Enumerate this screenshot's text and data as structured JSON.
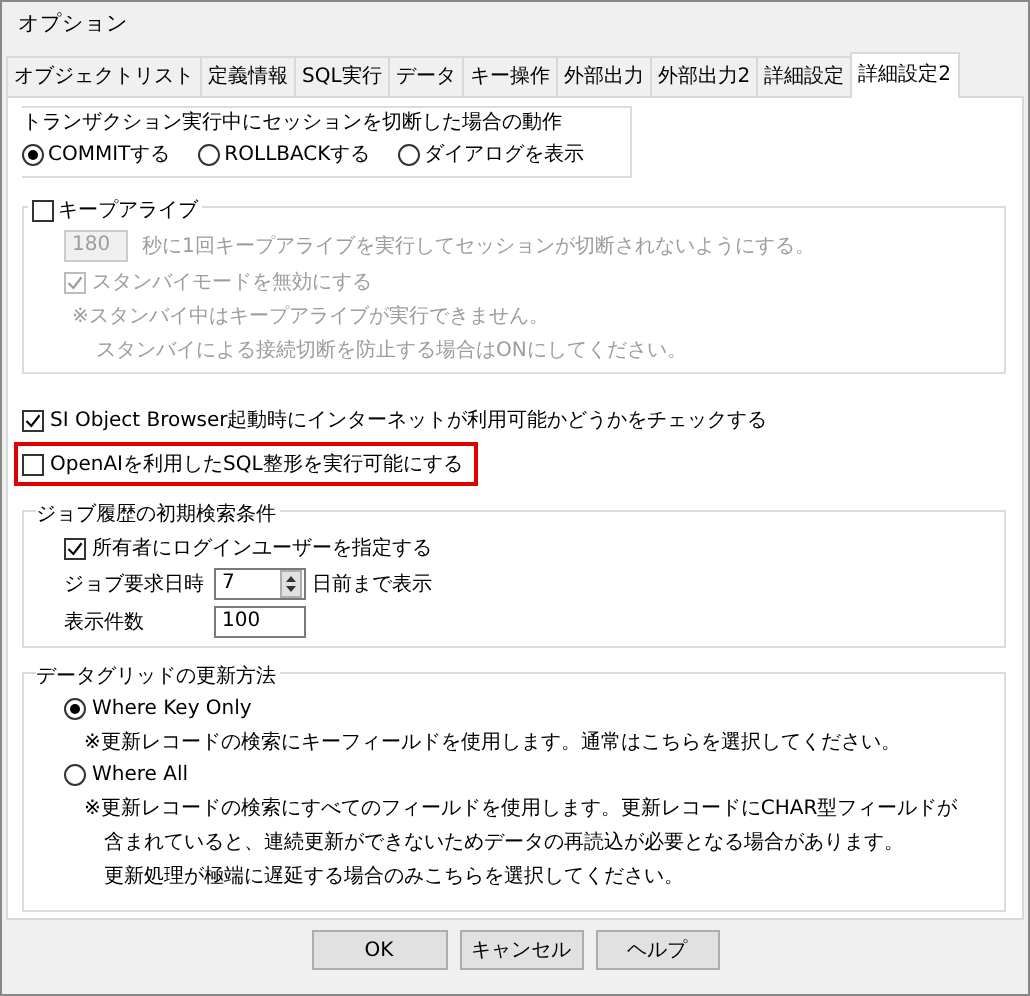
{
  "window": {
    "title": "オプション"
  },
  "tabs": [
    {
      "label": "オブジェクトリスト",
      "selected": false
    },
    {
      "label": "定義情報",
      "selected": false
    },
    {
      "label": "SQL実行",
      "selected": false
    },
    {
      "label": "データ",
      "selected": false
    },
    {
      "label": "キー操作",
      "selected": false
    },
    {
      "label": "外部出力",
      "selected": false
    },
    {
      "label": "外部出力2",
      "selected": false
    },
    {
      "label": "詳細設定",
      "selected": false
    },
    {
      "label": "詳細設定2",
      "selected": true
    }
  ],
  "transaction_group": {
    "title": "トランザクション実行中にセッションを切断した場合の動作",
    "options": [
      {
        "label": "COMMITする",
        "selected": true
      },
      {
        "label": "ROLLBACKする",
        "selected": false
      },
      {
        "label": "ダイアログを表示",
        "selected": false
      }
    ]
  },
  "keepalive_group": {
    "label": "キープアライブ",
    "checked": false,
    "disabled": true,
    "interval": "180",
    "interval_text": "秒に1回キープアライブを実行してセッションが切断されないようにする。",
    "standby": {
      "label": "スタンバイモードを無効にする",
      "checked": true
    },
    "notes": [
      "※スタンバイ中はキープアライブが実行できません。",
      "スタンバイによる接続切断を防止する場合はONにしてください。"
    ]
  },
  "options": [
    {
      "label": "SI Object Browser起動時にインターネットが利用可能かどうかをチェックする",
      "checked": true,
      "highlighted": false
    },
    {
      "label": "OpenAIを利用したSQL整形を実行可能にする",
      "checked": false,
      "highlighted": true
    }
  ],
  "job_history_group": {
    "title": "ジョブ履歴の初期検索条件",
    "owner": {
      "label": "所有者にログインユーザーを指定する",
      "checked": true
    },
    "request_date": {
      "label": "ジョブ要求日時",
      "value": "7",
      "suffix": "日前まで表示"
    },
    "display_count": {
      "label": "表示件数",
      "value": "100"
    }
  },
  "datagrid_group": {
    "title": "データグリッドの更新方法",
    "options": [
      {
        "label": "Where Key Only",
        "selected": true,
        "notes": [
          "※更新レコードの検索にキーフィールドを使用します。通常はこちらを選択してください。"
        ]
      },
      {
        "label": "Where All",
        "selected": false,
        "notes": [
          "※更新レコードの検索にすべてのフィールドを使用します。更新レコードにCHAR型フィールドが",
          "含まれていると、連続更新ができないためデータの再読込が必要となる場合があります。",
          "更新処理が極端に遅延する場合のみこちらを選択してください。"
        ]
      }
    ]
  },
  "buttons": [
    "OK",
    "キャンセル",
    "ヘルプ"
  ]
}
